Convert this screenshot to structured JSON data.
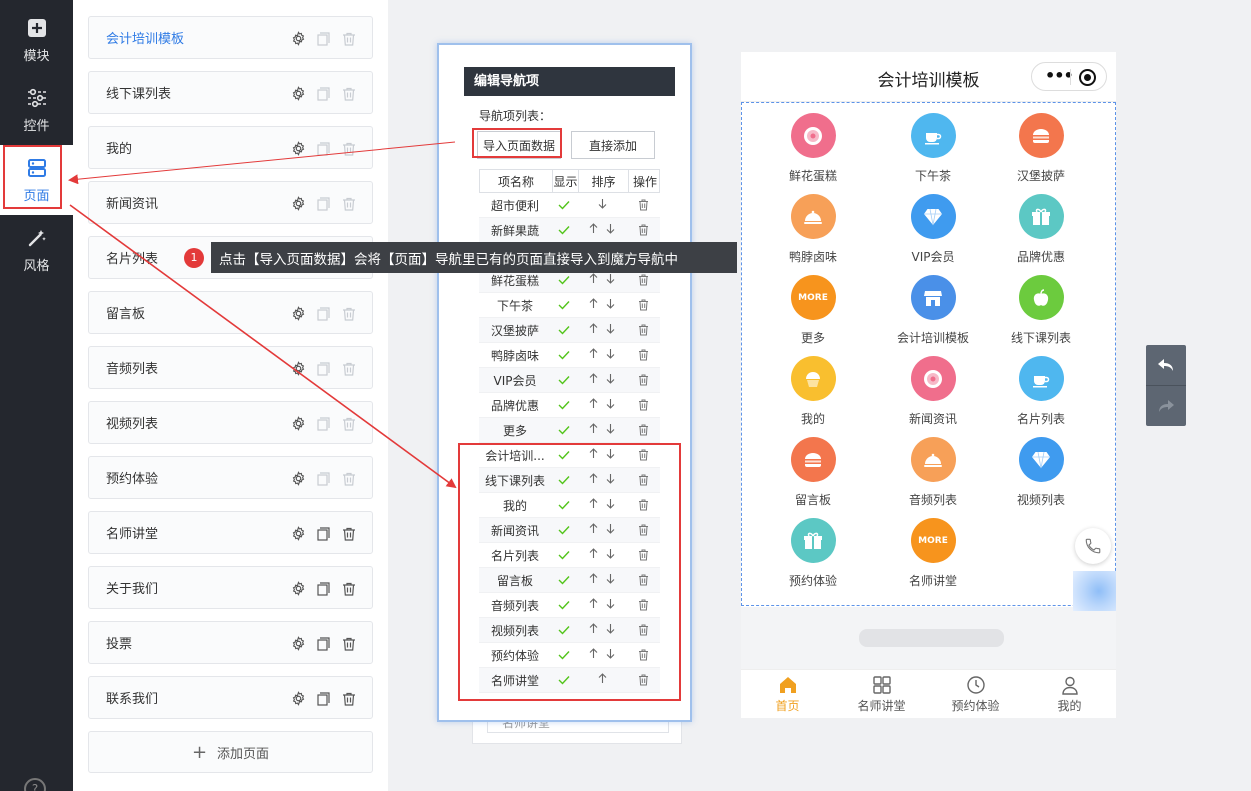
{
  "rail": {
    "items": [
      {
        "label": "模块",
        "icon": "plus-square-icon"
      },
      {
        "label": "控件",
        "icon": "sliders-icon"
      },
      {
        "label": "页面",
        "icon": "page-list-icon"
      },
      {
        "label": "风格",
        "icon": "magic-wand-icon"
      }
    ],
    "help": "?"
  },
  "pages": {
    "items": [
      "会计培训模板",
      "线下课列表",
      "我的",
      "新闻资讯",
      "名片列表",
      "留言板",
      "音频列表",
      "视频列表",
      "预约体验",
      "名师讲堂",
      "关于我们",
      "投票",
      "联系我们"
    ],
    "add_label": "添加页面",
    "add_symbol": "+"
  },
  "tooltip": {
    "badge": "1",
    "text": "点击【导入页面数据】会将【页面】导航里已有的页面直接导入到魔方导航中"
  },
  "editor": {
    "header": "编辑导航项",
    "list_label": "导航项列表：",
    "import_btn": "导入页面数据",
    "direct_add_btn": "直接添加",
    "columns": [
      "项名称",
      "显示",
      "排序",
      "操作"
    ],
    "rows": [
      {
        "name": "超市便利",
        "up": false,
        "down": true
      },
      {
        "name": "新鲜果蔬",
        "up": true,
        "down": true
      },
      {
        "name": "",
        "up": true,
        "down": true
      },
      {
        "name": "鲜花蛋糕",
        "up": true,
        "down": true
      },
      {
        "name": "下午茶",
        "up": true,
        "down": true
      },
      {
        "name": "汉堡披萨",
        "up": true,
        "down": true
      },
      {
        "name": "鸭脖卤味",
        "up": true,
        "down": true
      },
      {
        "name": "VIP会员",
        "up": true,
        "down": true
      },
      {
        "name": "品牌优惠",
        "up": true,
        "down": true
      },
      {
        "name": "更多",
        "up": true,
        "down": true
      },
      {
        "name": "会计培训...",
        "up": true,
        "down": true
      },
      {
        "name": "线下课列表",
        "up": true,
        "down": true
      },
      {
        "name": "我的",
        "up": true,
        "down": true
      },
      {
        "name": "新闻资讯",
        "up": true,
        "down": true
      },
      {
        "name": "名片列表",
        "up": true,
        "down": true
      },
      {
        "name": "留言板",
        "up": true,
        "down": true
      },
      {
        "name": "音频列表",
        "up": true,
        "down": true
      },
      {
        "name": "视频列表",
        "up": true,
        "down": true
      },
      {
        "name": "预约体验",
        "up": true,
        "down": true
      },
      {
        "name": "名师讲堂",
        "up": true,
        "down": false
      }
    ],
    "ghost_row": "名师讲堂"
  },
  "phone": {
    "title": "会计培训模板",
    "capsule_dots": "•••",
    "nav_items": [
      {
        "label": "鲜花蛋糕",
        "color": "#f06e8c",
        "icon": "donut-icon"
      },
      {
        "label": "下午茶",
        "color": "#4fb7ef",
        "icon": "coffee-cup-icon"
      },
      {
        "label": "汉堡披萨",
        "color": "#f3764d",
        "icon": "burger-icon"
      },
      {
        "label": "鸭脖卤味",
        "color": "#f7a058",
        "icon": "cloche-icon"
      },
      {
        "label": "VIP会员",
        "color": "#3f9bef",
        "icon": "diamond-icon"
      },
      {
        "label": "品牌优惠",
        "color": "#5cc8c4",
        "icon": "gift-icon"
      },
      {
        "label": "更多",
        "color": "#f7941d",
        "icon": "more-badge-icon",
        "text": "MORE"
      },
      {
        "label": "会计培训模板",
        "color": "#4a90e8",
        "icon": "shop-icon"
      },
      {
        "label": "线下课列表",
        "color": "#6ccb3e",
        "icon": "apple-icon"
      },
      {
        "label": "我的",
        "color": "#f9bf2f",
        "icon": "cupcake-icon"
      },
      {
        "label": "新闻资讯",
        "color": "#f06e8c",
        "icon": "donut-icon"
      },
      {
        "label": "名片列表",
        "color": "#4fb7ef",
        "icon": "coffee-cup-icon"
      },
      {
        "label": "留言板",
        "color": "#f3764d",
        "icon": "burger-icon"
      },
      {
        "label": "音频列表",
        "color": "#f7a058",
        "icon": "cloche-icon"
      },
      {
        "label": "视频列表",
        "color": "#3f9bef",
        "icon": "diamond-icon"
      },
      {
        "label": "预约体验",
        "color": "#5cc8c4",
        "icon": "gift-icon"
      },
      {
        "label": "名师讲堂",
        "color": "#f7941d",
        "icon": "more-badge-icon",
        "text": "MORE"
      }
    ],
    "tabs": [
      {
        "label": "首页",
        "icon": "home-icon",
        "active": true
      },
      {
        "label": "名师讲堂",
        "icon": "grid-icon",
        "active": false
      },
      {
        "label": "预约体验",
        "icon": "clock-icon",
        "active": false
      },
      {
        "label": "我的",
        "icon": "user-icon",
        "active": false
      }
    ]
  },
  "colors": {
    "accent_blue": "#2f7be5",
    "highlight_red": "#e33a3a",
    "tab_active": "#f0a020",
    "check_green": "#52c41a"
  }
}
